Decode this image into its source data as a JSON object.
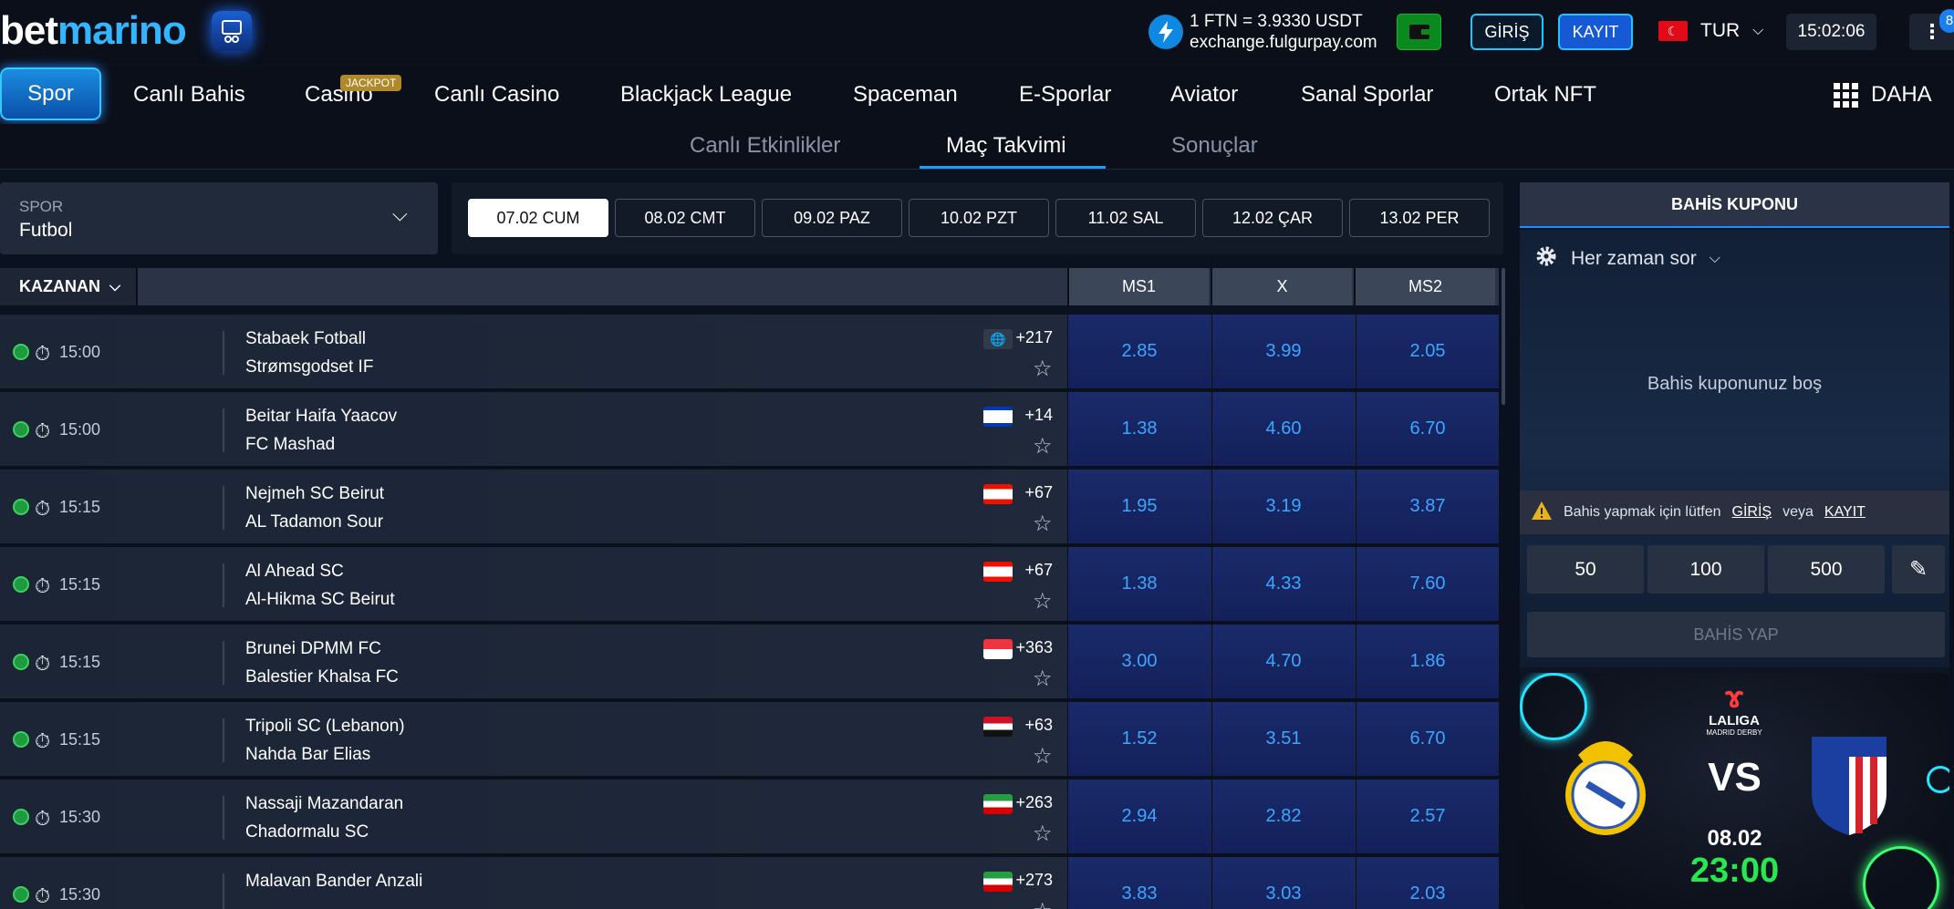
{
  "header": {
    "logo_part1": "bet",
    "logo_part2": "marino",
    "rate_line1": "1 FTN = 3.9330 USDT",
    "rate_line2": "exchange.fulgurpay.com",
    "login_label": "GİRİŞ",
    "register_label": "KAYIT",
    "language": "TUR",
    "clock": "15:02:06",
    "notification_count": "8"
  },
  "nav": {
    "items": [
      {
        "label": "Spor",
        "x": 0
      },
      {
        "label": "Canlı Bahis"
      },
      {
        "label": "Casino"
      },
      {
        "label": "Canlı Casino"
      },
      {
        "label": "Blackjack League"
      },
      {
        "label": "Spaceman"
      },
      {
        "label": "E-Sporlar"
      },
      {
        "label": "Aviator"
      },
      {
        "label": "Sanal Sporlar"
      },
      {
        "label": "Ortak NFT"
      }
    ],
    "jackpot_badge": "JACKPOT",
    "more_label": "DAHA"
  },
  "subtabs": [
    {
      "label": "Canlı Etkinlikler"
    },
    {
      "label": "Maç Takvimi"
    },
    {
      "label": "Sonuçlar"
    }
  ],
  "filter": {
    "sport_label": "SPOR",
    "sport_value": "Futbol",
    "dates": [
      "07.02 CUM",
      "08.02 CMT",
      "09.02 PAZ",
      "10.02 PZT",
      "11.02 SAL",
      "12.02 ÇAR",
      "13.02 PER"
    ]
  },
  "table": {
    "market_label": "KAZANAN",
    "columns": [
      "MS1",
      "X",
      "MS2"
    ],
    "rows": [
      {
        "time": "15:00",
        "team1": "Stabaek Fotball",
        "team2": "Strømsgodset IF",
        "flag": "globe",
        "more": "+217",
        "odds": [
          "2.85",
          "3.99",
          "2.05"
        ]
      },
      {
        "time": "15:00",
        "team1": "Beitar Haifa Yaacov",
        "team2": "FC Mashad",
        "flag": "il",
        "more": "+14",
        "odds": [
          "1.38",
          "4.60",
          "6.70"
        ]
      },
      {
        "time": "15:15",
        "team1": "Nejmeh SC Beirut",
        "team2": "AL Tadamon Sour",
        "flag": "lb",
        "more": "+67",
        "odds": [
          "1.95",
          "3.19",
          "3.87"
        ]
      },
      {
        "time": "15:15",
        "team1": "Al Ahead SC",
        "team2": "Al-Hikma SC Beirut",
        "flag": "lb",
        "more": "+67",
        "odds": [
          "1.38",
          "4.33",
          "7.60"
        ]
      },
      {
        "time": "15:15",
        "team1": "Brunei DPMM FC",
        "team2": "Balestier Khalsa FC",
        "flag": "sg",
        "more": "+363",
        "odds": [
          "3.00",
          "4.70",
          "1.86"
        ]
      },
      {
        "time": "15:15",
        "team1": "Tripoli SC (Lebanon)",
        "team2": "Nahda Bar Elias",
        "flag": "sy",
        "more": "+63",
        "odds": [
          "1.52",
          "3.51",
          "6.70"
        ]
      },
      {
        "time": "15:30",
        "team1": "Nassaji Mazandaran",
        "team2": "Chadormalu SC",
        "flag": "ir",
        "more": "+263",
        "odds": [
          "2.94",
          "2.82",
          "2.57"
        ]
      },
      {
        "time": "15:30",
        "team1": "Malavan Bander Anzali",
        "team2": "",
        "flag": "ir",
        "more": "+273",
        "odds": [
          "3.83",
          "3.03",
          "2.03"
        ]
      }
    ]
  },
  "betslip": {
    "title": "BAHİS KUPONU",
    "sort_label": "Her zaman sor",
    "empty_text": "Bahis kuponunuz boş",
    "warn_text": "Bahis yapmak için lütfen",
    "warn_login": "GİRİŞ",
    "warn_or": "veya",
    "warn_register": "KAYIT",
    "stakes": [
      "50",
      "100",
      "500"
    ],
    "place_label": "BAHİS YAP"
  },
  "promo": {
    "league": "LALIGA",
    "subtitle": "MADRID DERBY",
    "vs": "VS",
    "date": "08.02",
    "time": "23:00"
  },
  "colors": {
    "accent": "#1e9bff",
    "odds_text": "#3aa8ff",
    "promo_time": "#27e84d"
  }
}
